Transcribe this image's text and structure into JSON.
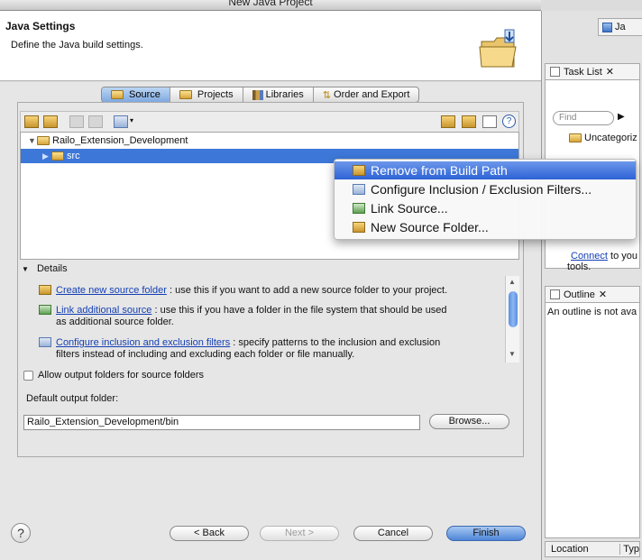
{
  "window": {
    "title": "New Java Project"
  },
  "header": {
    "title": "Java Settings",
    "description": "Define the Java build settings."
  },
  "tabs": [
    "Source",
    "Projects",
    "Libraries",
    "Order and Export"
  ],
  "tree": {
    "project": "Railo_Extension_Development",
    "source_folder": "src"
  },
  "context_menu": [
    "Remove from Build Path",
    "Configure Inclusion / Exclusion Filters...",
    "Link Source...",
    "New Source Folder..."
  ],
  "details": {
    "label": "Details",
    "items": [
      {
        "link": "Create new source folder",
        "text": ": use this if you want to add a new source folder to your project."
      },
      {
        "link": "Link additional source",
        "text": ": use this if you have a folder in the file system that should be used",
        "text2": "as additional source folder."
      },
      {
        "link": "Configure inclusion and exclusion filters",
        "text": ": specify patterns to the inclusion and exclusion",
        "text2": "filters instead of including and excluding each folder or file manually."
      }
    ]
  },
  "allow_output": {
    "label": "Allow output folders for source folders",
    "checked": false
  },
  "output_folder": {
    "label": "Default output folder:",
    "value": "Railo_Extension_Development/bin",
    "browse_label": "Browse..."
  },
  "buttons": {
    "back": "< Back",
    "next": "Next >",
    "cancel": "Cancel",
    "finish": "Finish"
  },
  "right_panel": {
    "top_label": "Ja",
    "task_list_title": "Task List",
    "find_placeholder": "Find",
    "uncategorized": "Uncategoriz",
    "connect_link": "Connect",
    "connect_text": "to you",
    "tools_text": "tools.",
    "outline_title": "Outline",
    "outline_text": "An outline is not ava",
    "location_header": "Location",
    "type_header": "Typ"
  },
  "colors": {
    "selection": "#3d78d9",
    "link": "#1540b5",
    "menu_highlight": "#2d62d5"
  }
}
